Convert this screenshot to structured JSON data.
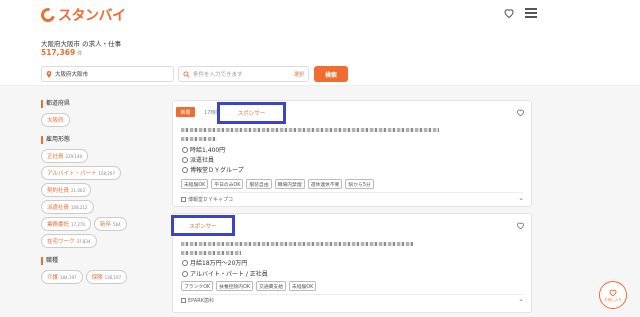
{
  "header": {
    "logo_text": "スタンバイ",
    "brand_color": "#ef6d2e",
    "icons": [
      "heart-icon",
      "menu-icon"
    ]
  },
  "search": {
    "area_title": "大阪府大阪市 の求人・仕事",
    "count": "517,369",
    "count_unit": "件",
    "location_value": "大阪府大阪市",
    "condition_placeholder": "条件を入力できます",
    "condition_select": "選択",
    "search_button": "検索"
  },
  "sidebar": {
    "prefecture_heading": "都道府県",
    "prefecture": "大阪府",
    "employment_heading": "雇用形態",
    "employment": [
      {
        "label": "正社員",
        "count": "229,149"
      },
      {
        "label": "アルバイト・パート",
        "count": "158,297"
      },
      {
        "label": "契約社員",
        "count": "21,063"
      },
      {
        "label": "派遣社員",
        "count": "108,212"
      },
      {
        "label": "業務委託",
        "count": "17,270"
      },
      {
        "label": "新卒",
        "count": "564"
      },
      {
        "label": "在宅ワーク",
        "count": "37,834"
      }
    ],
    "job_heading": "職種",
    "jobs": [
      {
        "label": "介護",
        "count": "184,197"
      },
      {
        "label": "保険",
        "count": "136,197"
      }
    ]
  },
  "cards": [
    {
      "badge": "新着",
      "time": "17時間前",
      "sponsor": "スポンサー",
      "salary": "時給1,400円",
      "employment": "派遣社員",
      "company": "博報堂ＤＹグループ",
      "tags": [
        "未経験OK",
        "平日のみOK",
        "服装自由",
        "職場内禁煙",
        "週休連休不要",
        "駅から5分"
      ],
      "source": "博報堂ＤＹキャプコ"
    },
    {
      "sponsor": "スポンサー",
      "salary": "月給18万円～20万円",
      "employment": "アルバイト・パート / 正社員",
      "tags": [
        "ブランクOK",
        "扶養控除内OK",
        "交通費支給",
        "未経験OK"
      ],
      "source": "EPARK歯科"
    }
  ],
  "fab": {
    "label": "お気に入り"
  },
  "colors": {
    "accent": "#ef6d2e",
    "highlight_box": "#3c45c7"
  }
}
